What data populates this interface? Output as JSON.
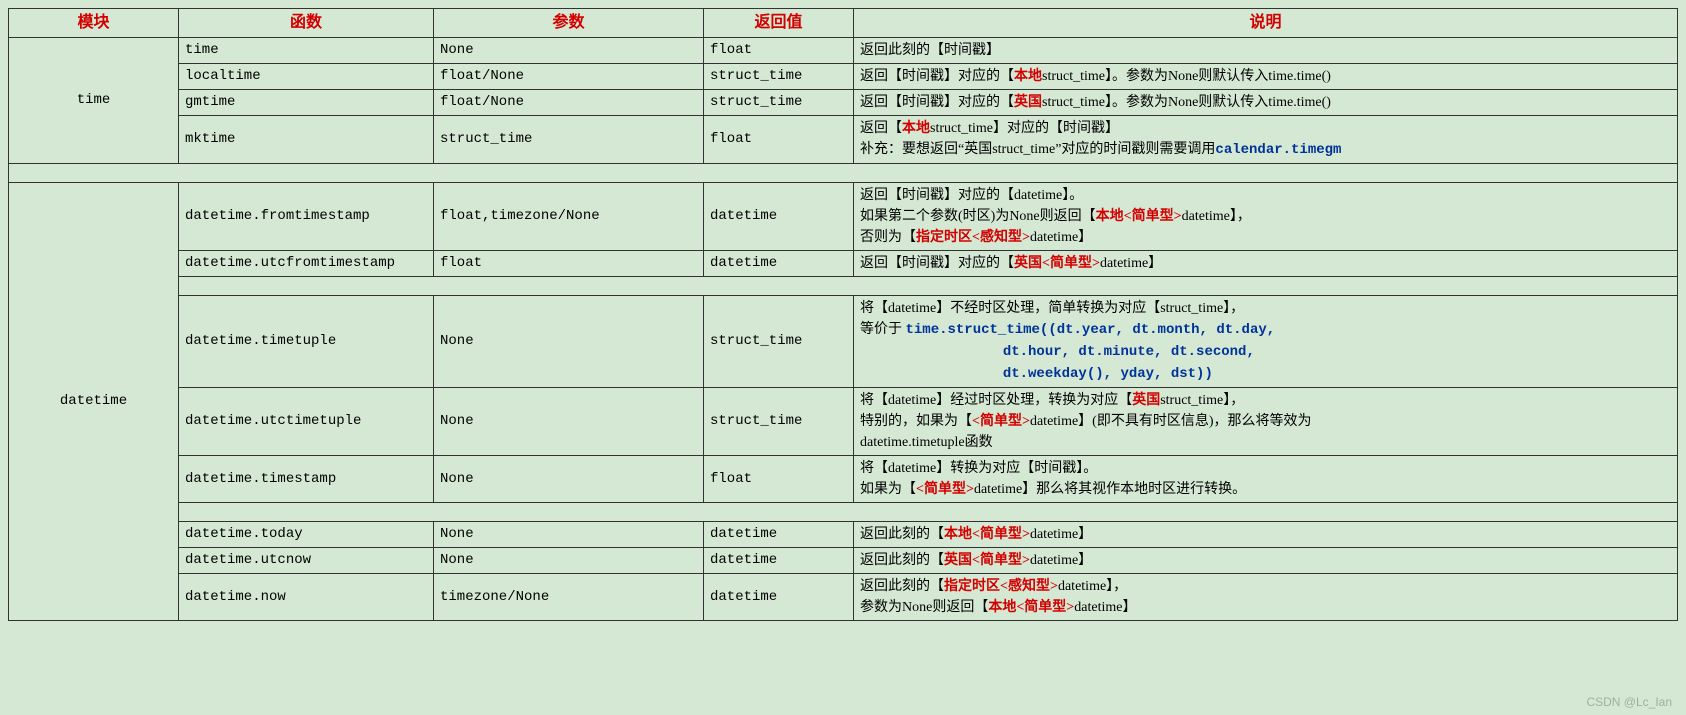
{
  "headers": {
    "module": "模块",
    "function": "函数",
    "params": "参数",
    "return": "返回值",
    "desc": "说明"
  },
  "watermark": "CSDN @Lc_Ian",
  "time_module": "time",
  "datetime_module": "datetime",
  "rows": {
    "t1": {
      "func": "time",
      "param": "None",
      "ret": "float",
      "desc_plain": "返回此刻的【时间戳】"
    },
    "t2": {
      "func": "localtime",
      "param": "float/None",
      "ret": "struct_time",
      "d_a": "返回【时间戳】对应的【",
      "d_b": "本地",
      "d_c": "struct_time】。参数为None则默认传入time.time()"
    },
    "t3": {
      "func": "gmtime",
      "param": "float/None",
      "ret": "struct_time",
      "d_a": "返回【时间戳】对应的【",
      "d_b": "英国",
      "d_c": "struct_time】。参数为None则默认传入time.time()"
    },
    "t4": {
      "func": "mktime",
      "param": "struct_time",
      "ret": "float",
      "l1_a": "返回【",
      "l1_b": "本地",
      "l1_c": "struct_time】对应的【时间戳】",
      "l2_a": "补充：要想返回“英国struct_time”对应的时间戳则需要调用",
      "l2_b": "calendar.timegm"
    },
    "d1": {
      "func": "datetime.fromtimestamp",
      "param": "float,timezone/None",
      "ret": "datetime",
      "l1": "返回【时间戳】对应的【datetime】。",
      "l2_a": "如果第二个参数(时区)为None则返回【",
      "l2_b": "本地<简单型>",
      "l2_c": "datetime】，",
      "l3_a": "否则为【",
      "l3_b": "指定时区<感知型>",
      "l3_c": "datetime】"
    },
    "d2": {
      "func": "datetime.utcfromtimestamp",
      "param": "float",
      "ret": "datetime",
      "d_a": "返回【时间戳】对应的【",
      "d_b": "英国<简单型>",
      "d_c": "datetime】"
    },
    "d3": {
      "func": "datetime.timetuple",
      "param": "None",
      "ret": "struct_time",
      "l1": "将【datetime】不经时区处理，简单转换为对应【struct_time】，",
      "l2_a": "等价于 ",
      "l2_b": "time.struct_time((dt.year, dt.month, dt.day,",
      "l3": "                 dt.hour, dt.minute, dt.second,",
      "l4": "                 dt.weekday(), yday, dst))"
    },
    "d4": {
      "func": "datetime.utctimetuple",
      "param": "None",
      "ret": "struct_time",
      "l1_a": "将【datetime】经过时区处理，转换为对应【",
      "l1_b": "英国",
      "l1_c": "struct_time】，",
      "l2_a": "特别的，如果为【",
      "l2_b": "<简单型>",
      "l2_c": "datetime】(即不具有时区信息)，那么将等效为",
      "l3": "datetime.timetuple函数"
    },
    "d5": {
      "func": "datetime.timestamp",
      "param": "None",
      "ret": "float",
      "l1": "将【datetime】转换为对应【时间戳】。",
      "l2_a": "如果为【",
      "l2_b": "<简单型>",
      "l2_c": "datetime】那么将其视作本地时区进行转换。"
    },
    "d6": {
      "func": "datetime.today",
      "param": "None",
      "ret": "datetime",
      "d_a": "返回此刻的【",
      "d_b": "本地<简单型>",
      "d_c": "datetime】"
    },
    "d7": {
      "func": "datetime.utcnow",
      "param": "None",
      "ret": "datetime",
      "d_a": "返回此刻的【",
      "d_b": "英国<简单型>",
      "d_c": "datetime】"
    },
    "d8": {
      "func": "datetime.now",
      "param": "timezone/None",
      "ret": "datetime",
      "l1_a": "返回此刻的【",
      "l1_b": "指定时区<感知型>",
      "l1_c": "datetime】，",
      "l2_a": "参数为None则返回【",
      "l2_b": "本地<简单型>",
      "l2_c": "datetime】"
    }
  }
}
